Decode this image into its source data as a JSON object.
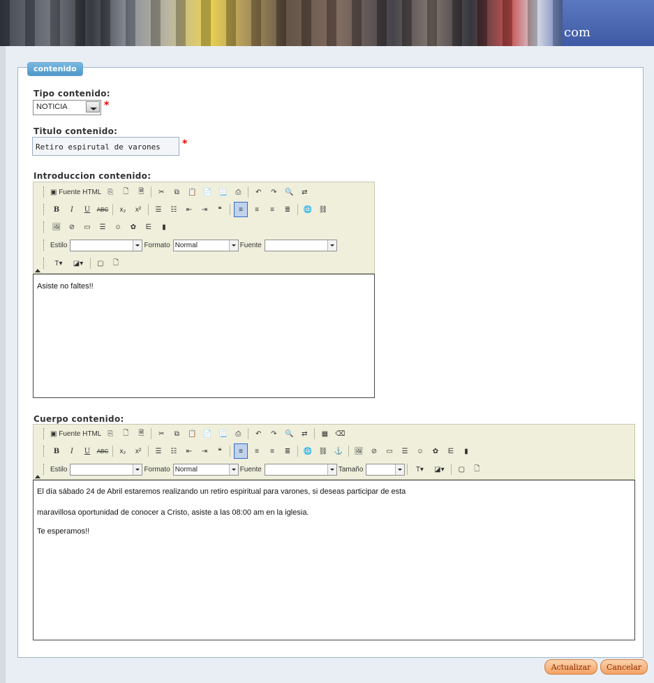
{
  "banner": {
    "text": "com"
  },
  "form": {
    "legend": "contenido",
    "tipo": {
      "label": "Tipo contenido:",
      "value": "NOTICIA"
    },
    "titulo": {
      "label": "Titulo contenido:",
      "value": "Retiro espirutal de varones"
    },
    "intro": {
      "label": "Introduccion contenido:",
      "content": "Asiste no faltes!!"
    },
    "cuerpo": {
      "label": "Cuerpo contenido:",
      "lines": [
        "El día sábado 24 de Abril estaremos realizando un retiro espiritual para varones, si deseas participar de esta",
        "maravillosa oportunidad de conocer a Cristo, asiste a las 08:00 am en la iglesia.",
        "Te esperamos!!"
      ]
    },
    "required_mark": "*"
  },
  "toolbar": {
    "source_label": "Fuente HTML",
    "style_label": "Estilo",
    "format_label": "Formato",
    "format_value": "Normal",
    "font_label": "Fuente",
    "size_label": "Tamaño",
    "bold": "B",
    "italic": "I",
    "underline": "U",
    "strike": "ABC",
    "sub": "x₂",
    "sup": "x²"
  },
  "buttons": {
    "update": "Actualizar",
    "cancel": "Cancelar"
  },
  "colors": {
    "legend": "#5aa7d8",
    "toolbar": "#efefdc",
    "button": "#f3a164",
    "required": "#ee0000"
  }
}
